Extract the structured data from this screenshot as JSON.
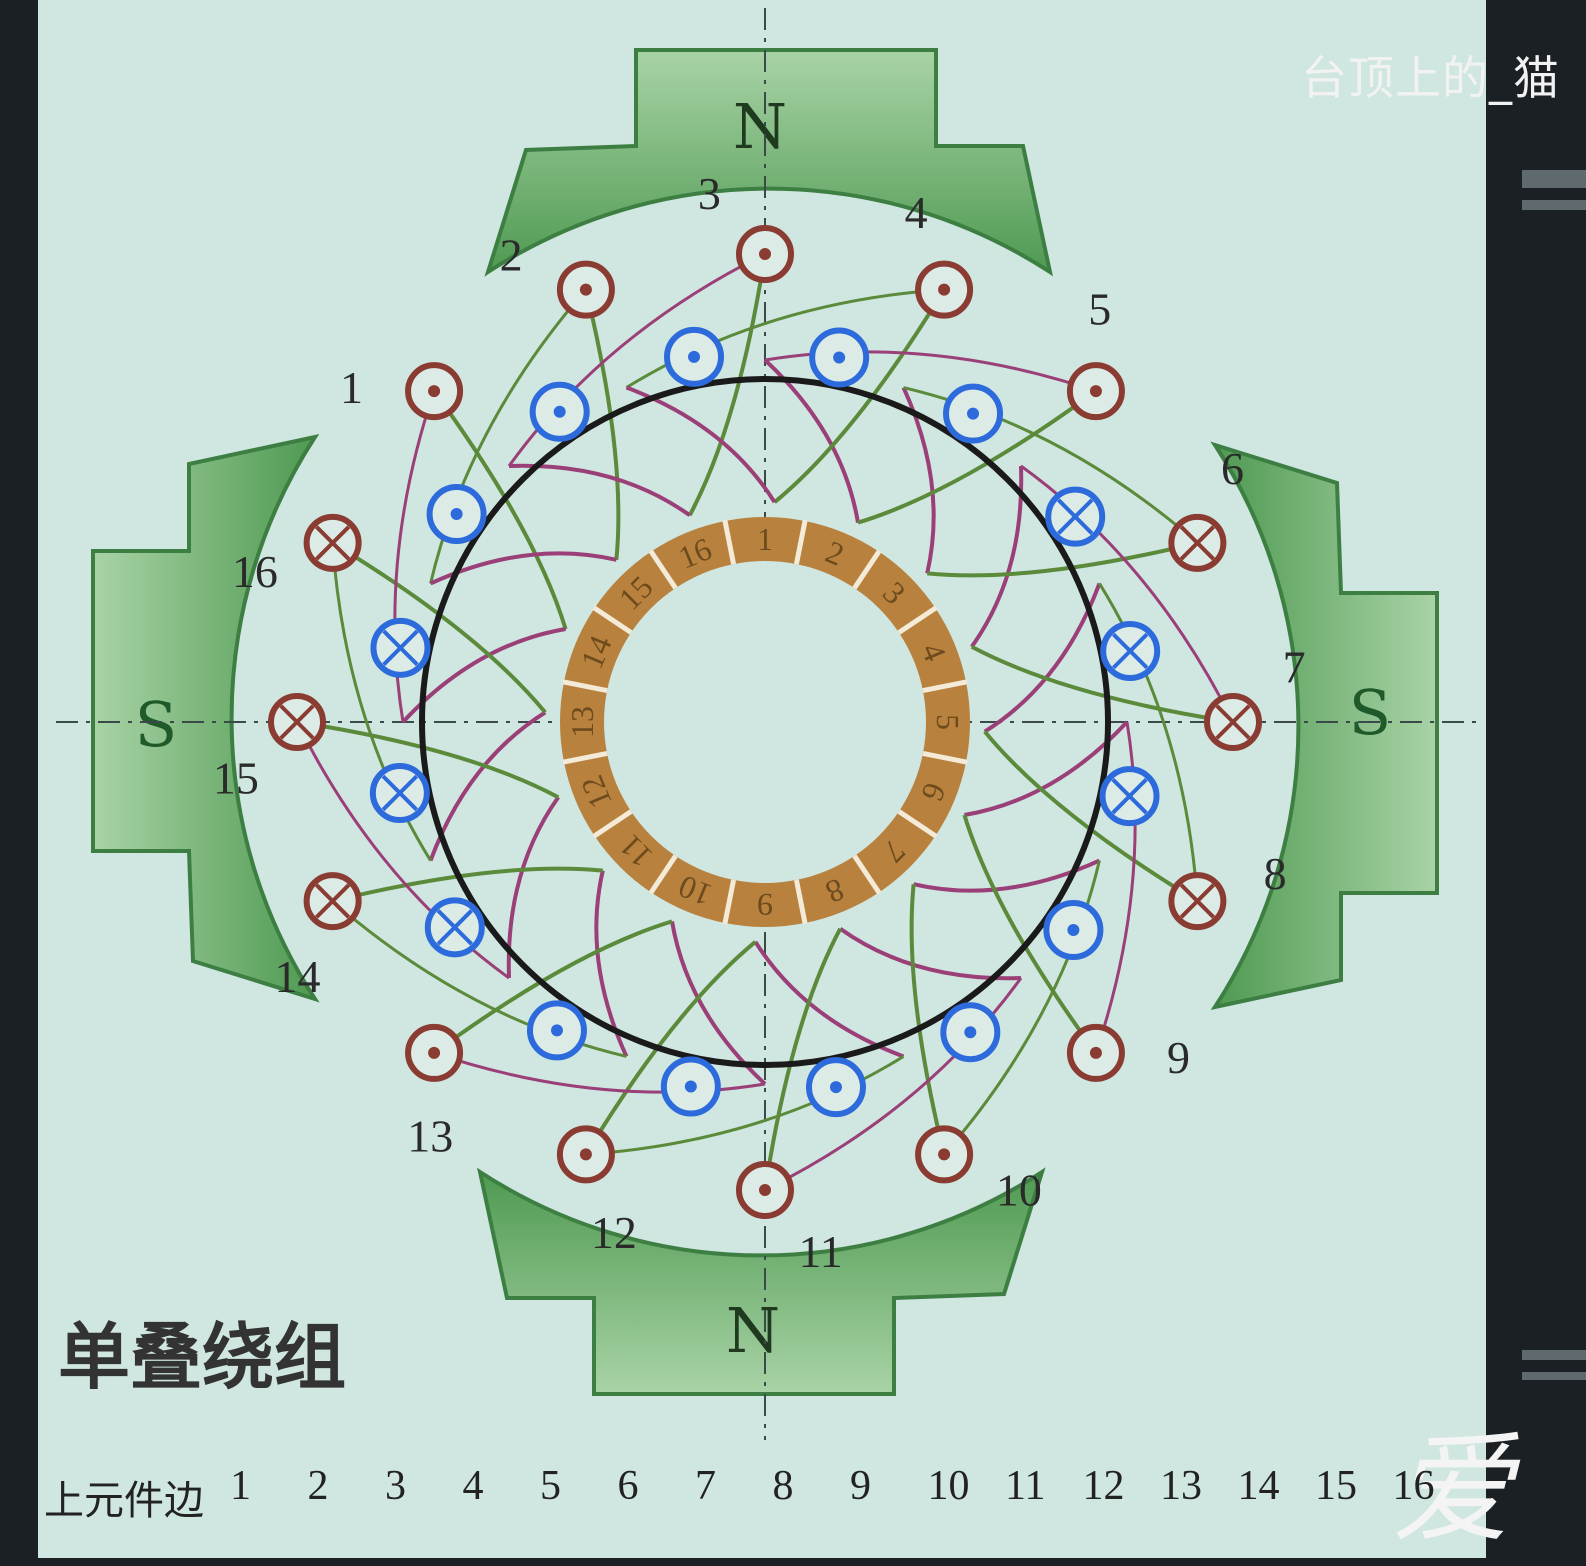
{
  "watermark": "台顶上的_猫",
  "caption": "单叠绕组",
  "corner_logo_text": "爱",
  "strip": {
    "label": "上元件边",
    "numbers": [
      "1",
      "2",
      "3",
      "4",
      "5",
      "6",
      "7",
      "8",
      "9",
      "10",
      "11",
      "12",
      "13",
      "14",
      "15",
      "16"
    ]
  },
  "poles": {
    "top": "N",
    "bottom": "N",
    "left": "S",
    "right": "S"
  },
  "slot_labels": [
    "1",
    "2",
    "3",
    "4",
    "5",
    "6",
    "7",
    "8",
    "9",
    "10",
    "11",
    "12",
    "13",
    "14",
    "15",
    "16"
  ],
  "commutator_labels": [
    "1",
    "2",
    "3",
    "4",
    "5",
    "6",
    "7",
    "8",
    "9",
    "10",
    "11",
    "12",
    "13",
    "14",
    "15",
    "16"
  ],
  "colors": {
    "background": "#cfe6e1",
    "pole": "#5fae61",
    "outer_conductor": "#8a3b32",
    "inner_conductor": "#2d6bdc",
    "wire_green": "#5b8a3a",
    "wire_purple": "#9b3f78",
    "commutator": "#b8823e"
  }
}
